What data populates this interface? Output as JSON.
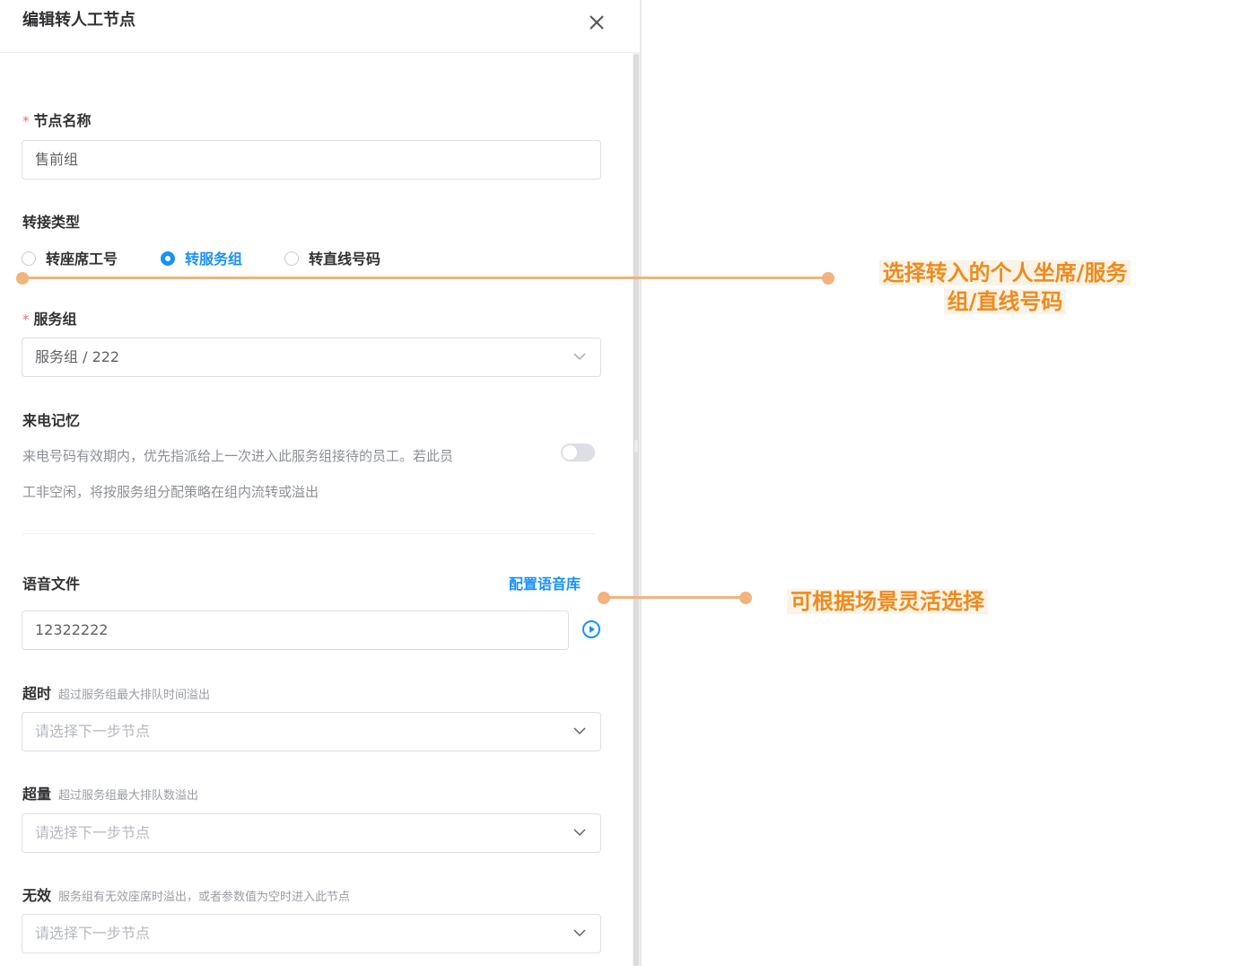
{
  "panel": {
    "title": "编辑转人工节点",
    "close_icon": "close-icon"
  },
  "form": {
    "node_name": {
      "label": "节点名称",
      "required_mark": "*",
      "value": "售前组"
    },
    "transfer_type": {
      "label": "转接类型",
      "options": [
        {
          "label": "转座席工号",
          "checked": false
        },
        {
          "label": "转服务组",
          "checked": true
        },
        {
          "label": "转直线号码",
          "checked": false
        }
      ]
    },
    "service_group": {
      "label": "服务组",
      "required_mark": "*",
      "value": "服务组 / 222"
    },
    "call_memory": {
      "label": "来电记忆",
      "description_line1": "来电号码有效期内，优先指派给上一次进入此服务组接待的员工。若此员",
      "description_line2": "工非空闲，将按服务组分配策略在组内流转或溢出",
      "enabled": false
    },
    "voice_file": {
      "label": "语音文件",
      "link": "配置语音库",
      "value": "12322222"
    },
    "timeout": {
      "label": "超时",
      "hint": "超过服务组最大排队时间溢出",
      "placeholder": "请选择下一步节点"
    },
    "overflow": {
      "label": "超量",
      "hint": "超过服务组最大排队数溢出",
      "placeholder": "请选择下一步节点"
    },
    "invalid": {
      "label": "无效",
      "hint": "服务组有无效座席时溢出，或者参数值为空时进入此节点",
      "placeholder": "请选择下一步节点"
    }
  },
  "annotations": {
    "transfer_note_line1": "选择转入的个人坐席/服务",
    "transfer_note_line2": "组/直线号码",
    "voice_note": "可根据场景灵活选择",
    "accent_color": "#f08a1c",
    "line_color": "#f2b37e"
  },
  "colors": {
    "primary": "#1890ff",
    "required": "#f56c6c"
  }
}
